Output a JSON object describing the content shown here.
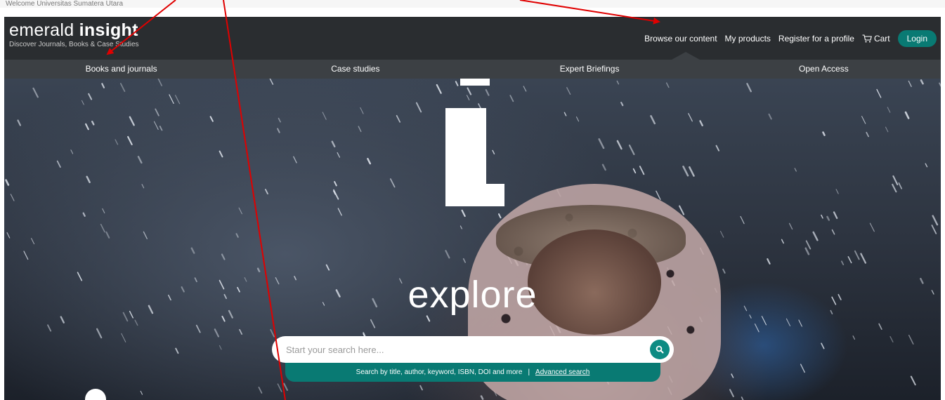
{
  "welcome_text": "Welcome Universitas Sumatera Utara",
  "logo": {
    "word_light": "emerald ",
    "word_bold": "insight",
    "tagline": "Discover Journals, Books & Case Studies"
  },
  "topnav": {
    "browse": "Browse our content",
    "products": "My products",
    "register": "Register for a profile",
    "cart": "Cart",
    "login": "Login"
  },
  "subnav": {
    "items": [
      {
        "label": "Books and journals"
      },
      {
        "label": "Case studies"
      },
      {
        "label": "Expert Briefings"
      },
      {
        "label": "Open Access"
      }
    ]
  },
  "hero": {
    "headline": "explore"
  },
  "search": {
    "placeholder": "Start your search here...",
    "hint": "Search by title, author, keyword, ISBN, DOI and more",
    "separator": "|",
    "advanced": "Advanced search"
  },
  "colors": {
    "header_bg": "#2a2d30",
    "subnav_bg": "#3c4044",
    "accent_teal": "#097a73",
    "annotation_red": "#e00000"
  },
  "icons": {
    "cart": "cart-icon",
    "search": "search-icon"
  }
}
